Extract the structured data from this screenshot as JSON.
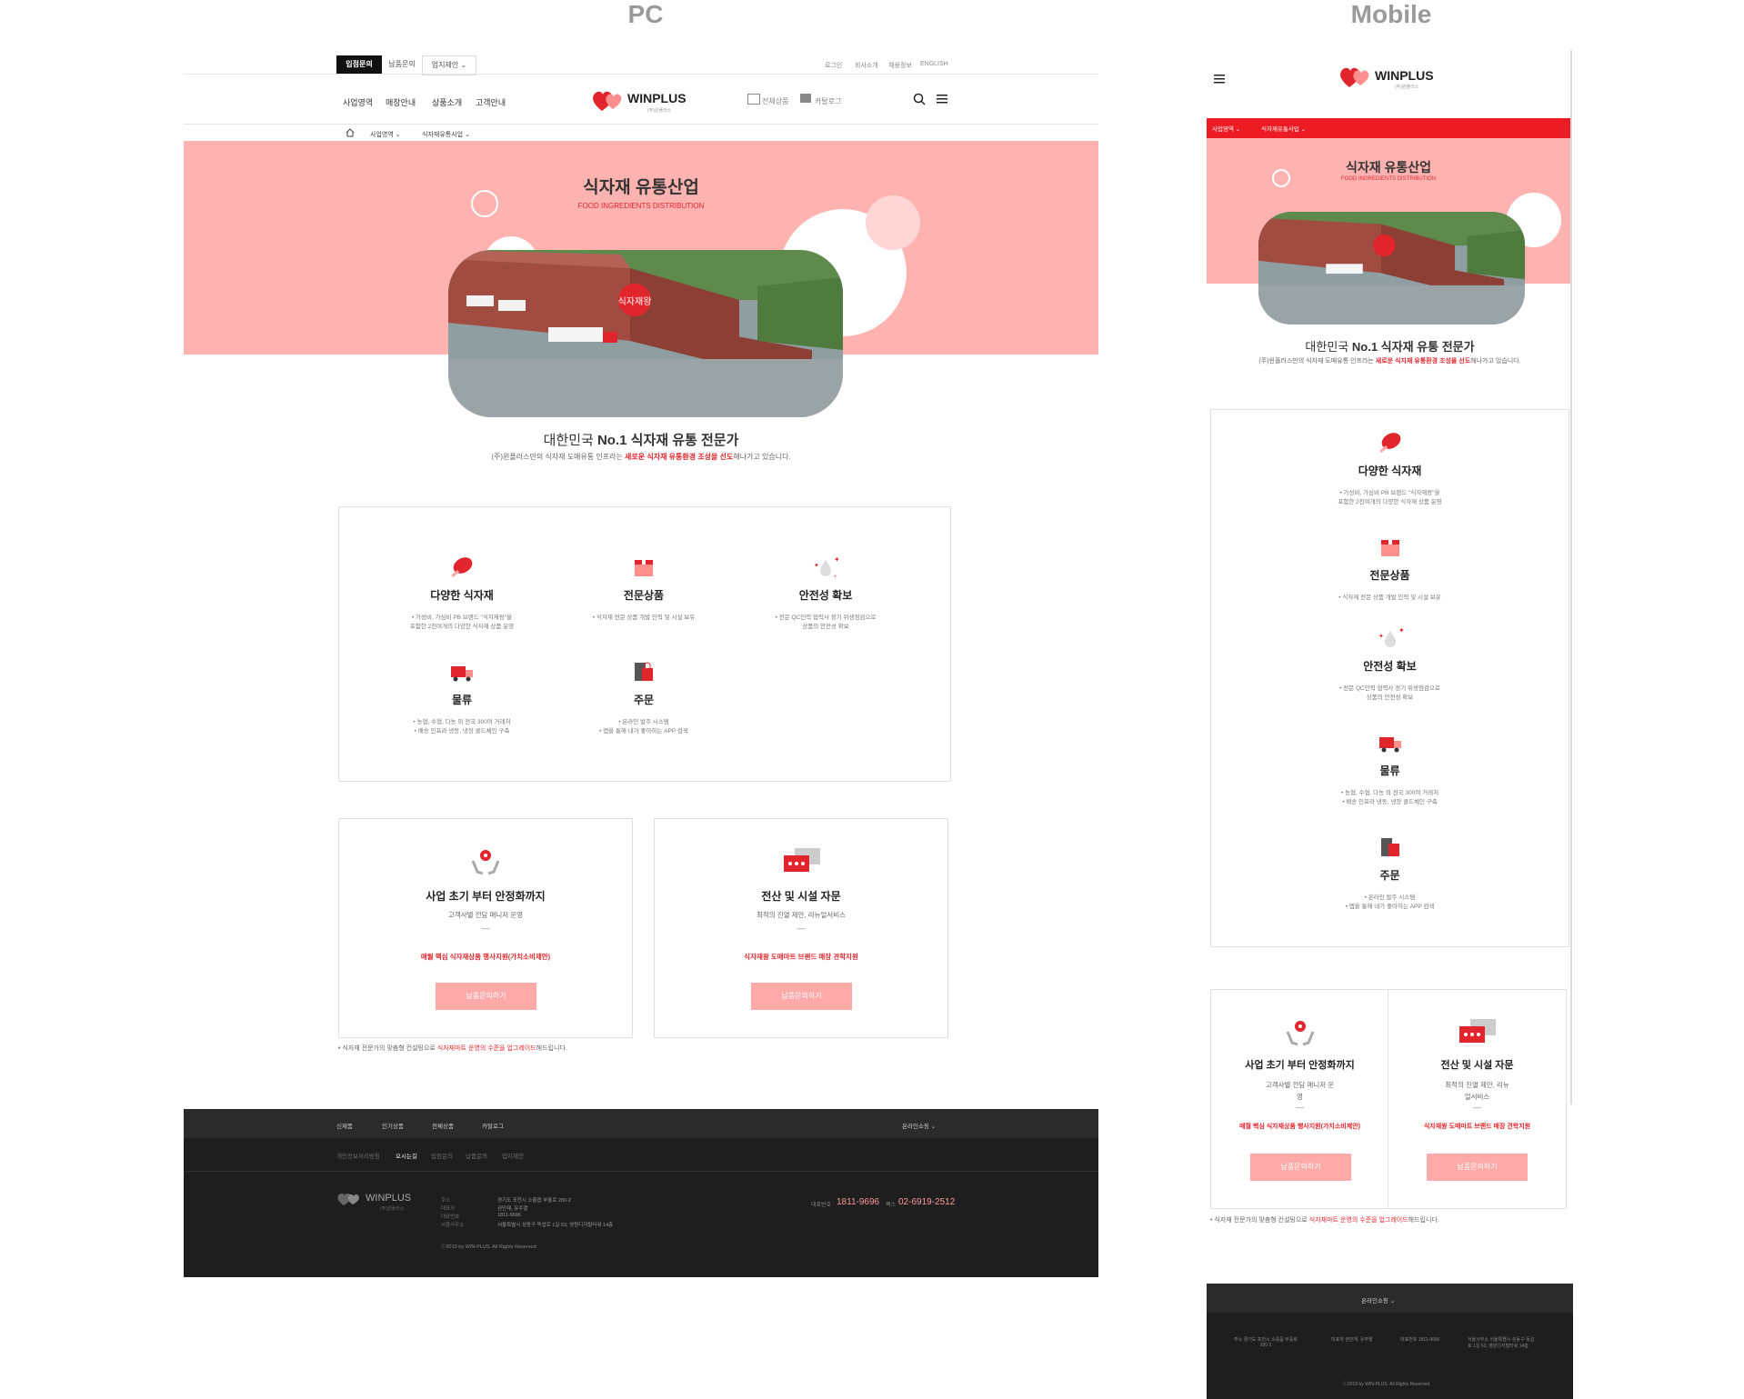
{
  "labels": {
    "pc": "PC",
    "mobile": "Mobile"
  },
  "top_bar": {
    "tab_active": "입점문의",
    "tab_other": "납품문의",
    "select_value": "업지제안",
    "links": [
      "로그인",
      "회사소개",
      "채용정보",
      "ENGLISH"
    ]
  },
  "nav": {
    "left": [
      "사업영역",
      "매장안내",
      "상품소개",
      "고객안내"
    ],
    "logo": "WINPLUS",
    "logo_sub": "(주)윈플러스",
    "right": [
      "전체상품",
      "카탈로그"
    ]
  },
  "breadcrumb": [
    "사업영역",
    "식자재유통사업"
  ],
  "hero": {
    "title": "식자재 유통산업",
    "subtitle": "FOOD INGREDIENTS DISTRIBUTION",
    "sign_text": "식자재왕"
  },
  "intro": {
    "headline_prefix": "대한민국",
    "headline_bold": "No.1 식자재 유통 전문가",
    "body_prefix": "(주)윈플러스만의 식자재 도매유통 인프라는",
    "body_highlight": "새로운 식자재 유통환경 조성을 선도",
    "body_suffix": "해나가고 있습니다."
  },
  "features": [
    {
      "icon": "meat-icon",
      "title": "다양한 식자재",
      "desc": "• 가성비, 가심비 PB 브랜드 \"식자재왕\"을\n포함한 2천여개의 다양한 식자재 상품 운영"
    },
    {
      "icon": "box-icon",
      "title": "전문상품",
      "desc": "• 식자재 전문 상품 개발 인력 및 시설 보유"
    },
    {
      "icon": "sparkle-drop-icon",
      "title": "안전성 확보",
      "desc": "• 전문 QC인력 협력사 정기 위생점검으로\n상품의 안전성 확보"
    },
    {
      "icon": "truck-icon",
      "title": "물류",
      "desc": "• 농협, 수협, 다농 외 전국 300여 거래처\n• 배송 인프라 냉동, 냉장 콜드체인 구축"
    },
    {
      "icon": "bag-icon",
      "title": "주문",
      "desc": "• 온라인 발주 시스템\n• 앱을 통해 내가 좋아하는 APP 검색"
    }
  ],
  "consult": [
    {
      "icon": "hands-gear-icon",
      "title": "사업 초기 부터 안정화까지",
      "sub": "고객사별 전담 매니저 운영",
      "dash": "—",
      "red": "매월 핵심 식자재상품 행사지원(가치소비제안)",
      "button": "납품문의하기"
    },
    {
      "icon": "chat-icon",
      "title": "전산 및 시설 자문",
      "sub": "최적의 진열 제안, 리뉴얼서비스",
      "dash": "—",
      "red": "식자재왕 도매마트 브랜드 매장 견학지원",
      "button": "납품문의하기"
    }
  ],
  "mobile_consult": [
    {
      "sub": "고객사별 전담 매니저 운\n영"
    },
    {
      "sub": "최적의 진열 제안, 리뉴\n얼서비스"
    }
  ],
  "note": {
    "prefix": "• 식자재 전문가의 맞춤형 컨설팅으로",
    "highlight": "식자재마트 운영의 수준을 업그레이드",
    "suffix": "해드립니다."
  },
  "footer": {
    "menu": [
      "신제품",
      "인기상품",
      "전체상품",
      "카탈로그"
    ],
    "shop_select": "온라인쇼핑",
    "policy_links": [
      "개인정보처리방침",
      "오시는길",
      "입점문의",
      "납품문의",
      "업지제안"
    ],
    "logo": "WINPLUS",
    "logo_sub": "(주)윈플러스",
    "info_labels": [
      "주소",
      "대표자",
      "대표번호",
      "서울사무소"
    ],
    "info_values": [
      "경기도 포천시 소흘읍 부흘로 280-2",
      "권민재, 유주열",
      "1811-9696",
      "서울특별시 성동구 독섭로 1길 63, 영원디지털타워 14층"
    ],
    "tel_label": "대표번호",
    "tel": "1811-9696",
    "fax_label": "팩스",
    "fax": "02-6919-2512",
    "copyright": "ⓒ2019 by WIN-PLUS. All Rights Reserved."
  },
  "mobile_footer": {
    "shop_select": "온라인쇼핑",
    "addr": "주소 경기도 포천시 소흘읍 부흘로\n280-2",
    "ceo": "대표자 권민재, 유주열",
    "tel": "대표번호 1811-9696",
    "seoul": "서울사무소 서울특별시 성동구 독섭\n로 1길 63, 영원디지털타워 14층",
    "copyright": "ⓒ2019 by WIN-PLUS. All Rights Reserved."
  },
  "colors": {
    "accent": "#e2252c",
    "hero_bg": "#ffb3b1",
    "button": "#ffaaa8",
    "footer": "#1e1e1e"
  }
}
